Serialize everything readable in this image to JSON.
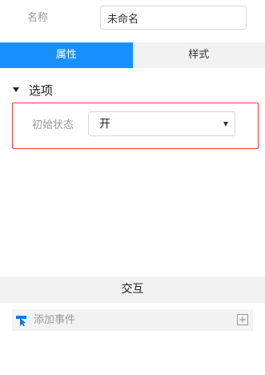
{
  "form": {
    "name_label": "名称",
    "name_value": "未命名"
  },
  "tabs": [
    {
      "label": "属性",
      "active": true
    },
    {
      "label": "样式",
      "active": false
    }
  ],
  "options_section": {
    "title": "选项",
    "expanded": true,
    "initial_state_label": "初始状态",
    "initial_state_value": "开"
  },
  "interaction": {
    "title": "交互",
    "add_event_label": "添加事件"
  },
  "colors": {
    "accent": "#1890ff",
    "highlight_border": "#e63c3c",
    "event_icon": "#1677d6"
  },
  "icons": {
    "section_toggle": "caret-down-icon",
    "select_arrow": "triangle-down-icon",
    "event": "cursor-event-icon",
    "add": "plus-square-icon"
  }
}
